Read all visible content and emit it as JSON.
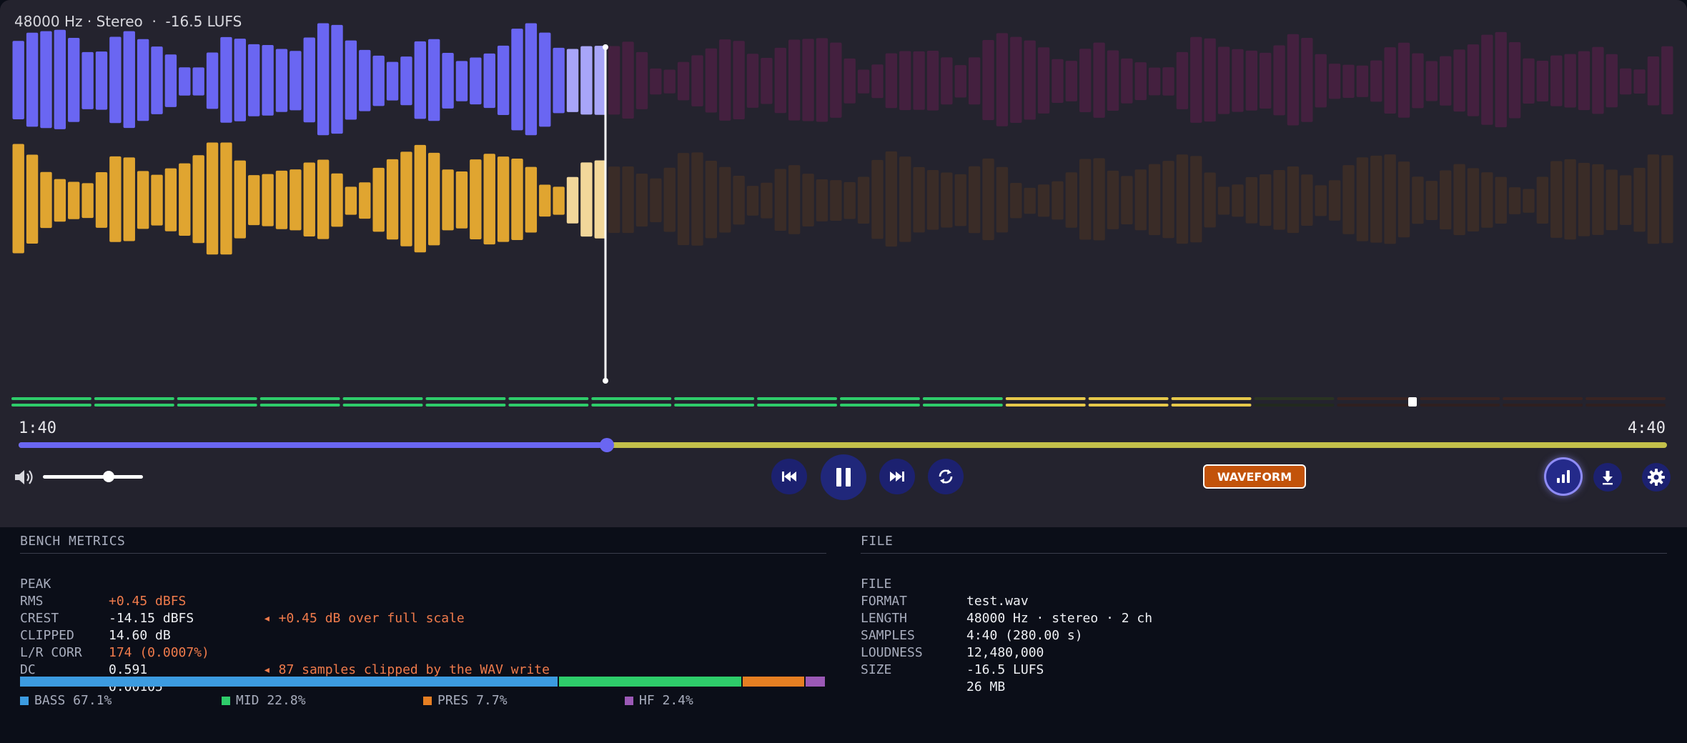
{
  "player": {
    "info_line": "48000 Hz · Stereo  ·  -16.5 LUFS",
    "time_current": "1:40",
    "time_total": "4:40",
    "progress_fraction": 0.3571,
    "volume_fraction": 0.66,
    "waveform_button_label": "WAVEFORM",
    "colors": {
      "channel_left": "#6a66f2",
      "channel_right": "#e0a530",
      "seek_played": "#6a66f2",
      "seek_remaining": "#c3c04a",
      "waveform_button": "#c2530a"
    },
    "icons": {
      "volume": "speaker-icon",
      "prev": "skip-previous-icon",
      "pause": "pause-icon",
      "next": "skip-next-icon",
      "loop": "loop-icon",
      "stats": "bar-chart-icon",
      "download": "download-icon",
      "settings": "gear-icon"
    }
  },
  "bench_metrics": {
    "title": "BENCH METRICS",
    "rows": [
      {
        "key": "PEAK",
        "value": "+0.45 dBFS",
        "warn": true,
        "note": "◂ +0.45 dB over full scale"
      },
      {
        "key": "RMS",
        "value": "-14.15 dBFS",
        "warn": false,
        "note": ""
      },
      {
        "key": "CREST",
        "value": "14.60 dB",
        "warn": false,
        "note": ""
      },
      {
        "key": "CLIPPED",
        "value": "174 (0.0007%)",
        "warn": true,
        "note": "◂ 87 samples clipped by the WAV write"
      },
      {
        "key": "L/R CORR",
        "value": "0.591",
        "warn": false,
        "note": ""
      },
      {
        "key": "DC",
        "value": "0.00105",
        "warn": false,
        "note": ""
      }
    ],
    "bands": [
      {
        "label": "BASS 67.1%",
        "share": 67.1,
        "color": "#3c9be0"
      },
      {
        "label": "MID 22.8%",
        "share": 22.8,
        "color": "#2ecc6a"
      },
      {
        "label": "PRES 7.7%",
        "share": 7.7,
        "color": "#e67e22"
      },
      {
        "label": "HF 2.4%",
        "share": 2.4,
        "color": "#9b59b6"
      }
    ]
  },
  "file": {
    "title": "FILE",
    "rows": [
      {
        "key": "FILE",
        "value": "test.wav"
      },
      {
        "key": "FORMAT",
        "value": "48000 Hz · stereo · 2 ch"
      },
      {
        "key": "LENGTH",
        "value": "4:40 (280.00 s)"
      },
      {
        "key": "SAMPLES",
        "value": "12,480,000"
      },
      {
        "key": "LOUDNESS",
        "value": "-16.5 LUFS"
      },
      {
        "key": "SIZE",
        "value": "26 MB"
      }
    ]
  }
}
